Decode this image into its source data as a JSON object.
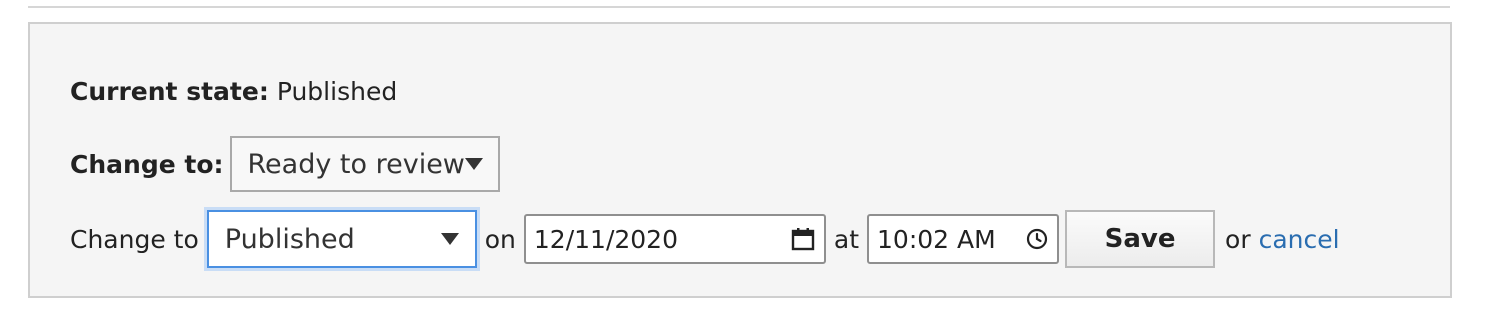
{
  "current_state": {
    "label": "Current state:",
    "value": "Published"
  },
  "change_to": {
    "label": "Change to:",
    "selected": "Ready to review"
  },
  "schedule": {
    "prefix": "Change to",
    "selected": "Published",
    "on_word": "on",
    "date_value": "12/11/2020",
    "at_word": "at",
    "time_value": "10:02 AM",
    "save_label": "Save",
    "or_word": "or",
    "cancel_label": "cancel"
  },
  "colors": {
    "panel_background": "#f5f5f5",
    "link": "#2a6db0",
    "focus_border": "#4a90e2"
  },
  "icons": {
    "date_icon": "calendar-icon",
    "time_icon": "clock-icon",
    "select_icon": "chevron-down-icon"
  }
}
